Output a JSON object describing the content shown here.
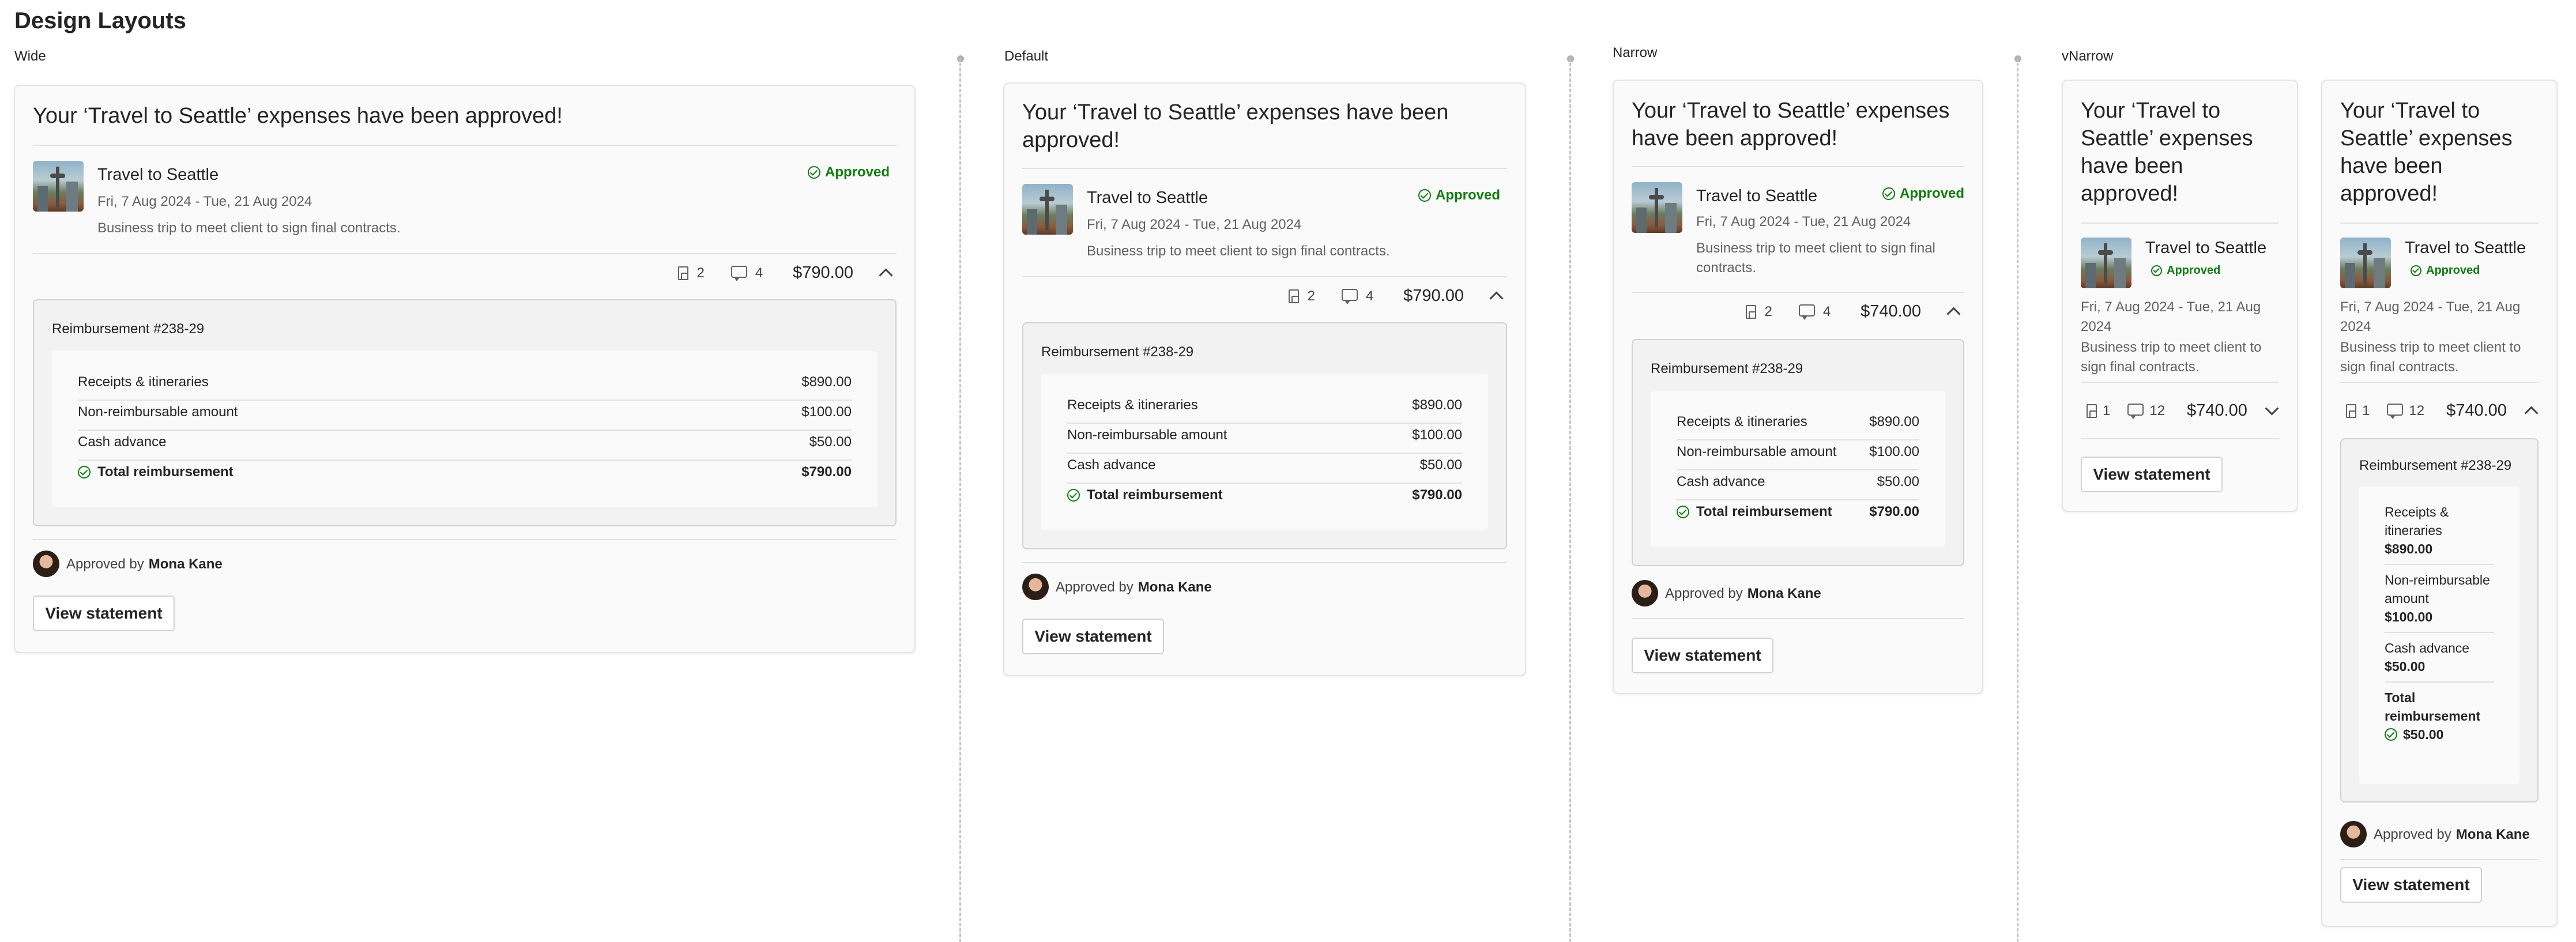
{
  "page": {
    "title": "Design Layouts",
    "sections": {
      "wide": "Wide",
      "default": "Default",
      "narrow": "Narrow",
      "vnarrow": "vNarrow"
    }
  },
  "card": {
    "title": "Your ‘Travel to Seattle’ expenses have been approved!",
    "trip_title": "Travel to Seattle",
    "dates": "Fri, 7 Aug 2024 - Tue, 21 Aug 2024",
    "description": "Business trip to meet client to sign final contracts.",
    "status": "Approved",
    "approved_by_label": "Approved by",
    "approver": "Mona Kane",
    "view_statement": "View statement",
    "reimbursement_title": "Reimbursement #238-29",
    "labels": {
      "receipts": "Receipts & itineraries",
      "nonreimb": "Non-reimbursable amount",
      "cash": "Cash advance",
      "total": "Total reimbursement"
    }
  },
  "wide": {
    "attachments": "2",
    "comments": "4",
    "amount": "$790.00",
    "receipts": "$890.00",
    "nonreimb": "$100.00",
    "cash": "$50.00",
    "total": "$790.00"
  },
  "default": {
    "attachments": "2",
    "comments": "4",
    "amount": "$790.00",
    "receipts": "$890.00",
    "nonreimb": "$100.00",
    "cash": "$50.00",
    "total": "$790.00"
  },
  "narrow": {
    "attachments": "2",
    "comments": "4",
    "amount": "$740.00",
    "receipts": "$890.00",
    "nonreimb": "$100.00",
    "cash": "$50.00",
    "total": "$790.00"
  },
  "vnarrow_collapsed": {
    "attachments": "1",
    "comments": "12",
    "amount": "$740.00"
  },
  "vnarrow_expanded": {
    "attachments": "1",
    "comments": "12",
    "amount": "$740.00",
    "receipts_l1": "Receipts &",
    "receipts_l2": "itineraries",
    "receipts": "$890.00",
    "nonreimb_l1": "Non-reimbursable",
    "nonreimb_l2": "amount",
    "nonreimb": "$100.00",
    "cash": "$50.00",
    "total_l1": "Total",
    "total_l2": "reimbursement",
    "total": "$50.00"
  }
}
